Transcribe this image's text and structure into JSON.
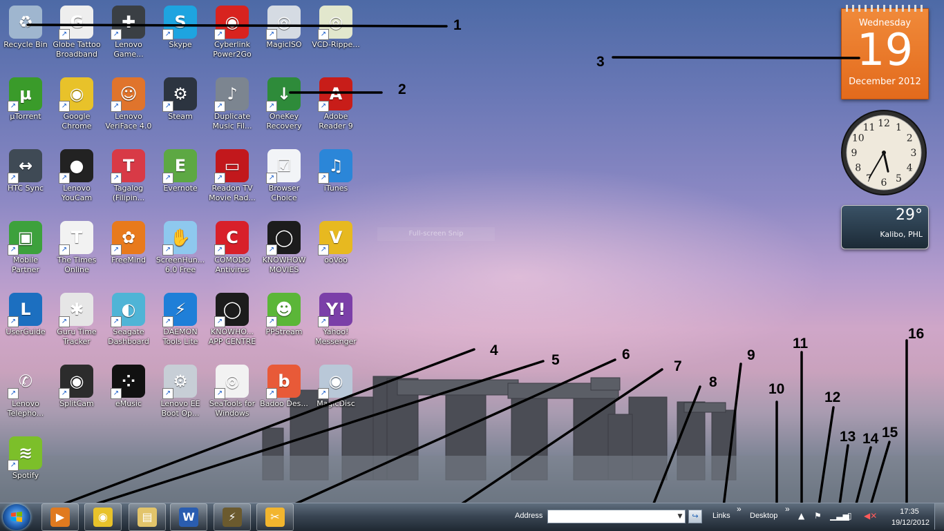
{
  "desktop": {
    "icons": [
      {
        "label": "Recycle Bin",
        "icon": "recycle-bin-icon",
        "color": "#9fb6cf",
        "glyph": "♻"
      },
      {
        "label": "Globe Tattoo Broadband",
        "icon": "globe-tattoo-icon",
        "color": "#eeeeee",
        "glyph": "G"
      },
      {
        "label": "Lenovo Game...",
        "icon": "gamepad-icon",
        "color": "#3a3f44",
        "glyph": "✚"
      },
      {
        "label": "Skype",
        "icon": "skype-icon",
        "color": "#1ea4e0",
        "glyph": "S"
      },
      {
        "label": "Cyberlink Power2Go",
        "icon": "cyberlink-icon",
        "color": "#d8231f",
        "glyph": "◉"
      },
      {
        "label": "MagicISO",
        "icon": "disc-icon",
        "color": "#d5dbe3",
        "glyph": "◎"
      },
      {
        "label": "VCD-Rippe...",
        "icon": "vcd-ripper-icon",
        "color": "#e2e7cd",
        "glyph": "◎"
      },
      {
        "label": "µTorrent",
        "icon": "utorrent-icon",
        "color": "#3a9b2a",
        "glyph": "µ"
      },
      {
        "label": "Google Chrome",
        "icon": "chrome-icon",
        "color": "#e8c22a",
        "glyph": "◉"
      },
      {
        "label": "Lenovo VeriFace 4.0",
        "icon": "veriface-icon",
        "color": "#e0742c",
        "glyph": "☺"
      },
      {
        "label": "Steam",
        "icon": "steam-icon",
        "color": "#2c3440",
        "glyph": "⚙"
      },
      {
        "label": "Duplicate Music Fil...",
        "icon": "speaker-icon",
        "color": "#7c8590",
        "glyph": "♪"
      },
      {
        "label": "OneKey Recovery",
        "icon": "onekey-recovery-icon",
        "color": "#2e8b3a",
        "glyph": "↓"
      },
      {
        "label": "Adobe Reader 9",
        "icon": "adobe-reader-icon",
        "color": "#c81d19",
        "glyph": "A"
      },
      {
        "label": "HTC Sync",
        "icon": "htc-sync-icon",
        "color": "#3f4a55",
        "glyph": "↔"
      },
      {
        "label": "Lenovo YouCam",
        "icon": "webcam-icon",
        "color": "#222222",
        "glyph": "●"
      },
      {
        "label": "Tagalog (Filipin...",
        "icon": "tagalog-icon",
        "color": "#d83a46",
        "glyph": "T"
      },
      {
        "label": "Evernote",
        "icon": "evernote-icon",
        "color": "#5da843",
        "glyph": "E"
      },
      {
        "label": "Readon TV Movie Rad...",
        "icon": "readon-tv-icon",
        "color": "#c2181c",
        "glyph": "▭"
      },
      {
        "label": "Browser Choice",
        "icon": "browser-choice-icon",
        "color": "#f2f4f7",
        "glyph": "☑"
      },
      {
        "label": "iTunes",
        "icon": "itunes-icon",
        "color": "#2b86d8",
        "glyph": "♫"
      },
      {
        "label": "Mobile Partner",
        "icon": "mobile-partner-icon",
        "color": "#3da13c",
        "glyph": "▣"
      },
      {
        "label": "The Times Online",
        "icon": "times-icon",
        "color": "#f2f2f2",
        "glyph": "T"
      },
      {
        "label": "FreeMind",
        "icon": "butterfly-icon",
        "color": "#e87a1c",
        "glyph": "✿"
      },
      {
        "label": "ScreenHun... 6.0 Free",
        "icon": "screenhunter-icon",
        "color": "#8ec8ee",
        "glyph": "✋"
      },
      {
        "label": "COMODO Antivirus",
        "icon": "comodo-icon",
        "color": "#d8202a",
        "glyph": "C"
      },
      {
        "label": "KNOWHOW MOVIES",
        "icon": "knowhow-movies-icon",
        "color": "#1c1c1c",
        "glyph": "◯"
      },
      {
        "label": "ooVoo",
        "icon": "oovoo-icon",
        "color": "#e7b920",
        "glyph": "V"
      },
      {
        "label": "UserGuide",
        "icon": "user-guide-icon",
        "color": "#1c6fc0",
        "glyph": "L"
      },
      {
        "label": "Guru Time Tracker",
        "icon": "guru-icon",
        "color": "#e6e6e6",
        "glyph": "✱"
      },
      {
        "label": "Seagate Dashboard",
        "icon": "seagate-icon",
        "color": "#4fb4d6",
        "glyph": "◐"
      },
      {
        "label": "DAEMON Tools Lite",
        "icon": "daemon-tools-icon",
        "color": "#1f7fd8",
        "glyph": "⚡"
      },
      {
        "label": "KNOWHO... APP CENTRE",
        "icon": "knowhow-app-icon",
        "color": "#1c1c1c",
        "glyph": "◯"
      },
      {
        "label": "PPStream",
        "icon": "ppstream-icon",
        "color": "#5bb638",
        "glyph": "☻"
      },
      {
        "label": "Yahoo! Messenger",
        "icon": "yahoo-messenger-icon",
        "color": "#7b3fa8",
        "glyph": "Y!"
      },
      {
        "label": "Lenovo Telepho...",
        "icon": "telephone-icon",
        "color": "transparent",
        "glyph": "✆"
      },
      {
        "label": "SplitCam",
        "icon": "splitcam-icon",
        "color": "#2c2c2c",
        "glyph": "◉"
      },
      {
        "label": "eMusic",
        "icon": "emusic-icon",
        "color": "#111111",
        "glyph": "⁘"
      },
      {
        "label": "Lenovo EE Boot Op...",
        "icon": "gear-icon",
        "color": "#c7ced6",
        "glyph": "⚙"
      },
      {
        "label": "SeaTools for Windows",
        "icon": "seatools-icon",
        "color": "#f2f2f2",
        "glyph": "◎"
      },
      {
        "label": "Badoo Des...",
        "icon": "badoo-icon",
        "color": "#e85a38",
        "glyph": "b"
      },
      {
        "label": "MagicDisc",
        "icon": "magicdisc-icon",
        "color": "#b9c8d8",
        "glyph": "◉"
      },
      {
        "label": "Spotify",
        "icon": "spotify-icon",
        "color": "#7cbf2a",
        "glyph": "≋"
      }
    ]
  },
  "gadgets": {
    "calendar": {
      "weekday": "Wednesday",
      "day": "19",
      "month_year": "December 2012"
    },
    "clock": {
      "hour": 5,
      "minute": 35,
      "numerals": [
        "12",
        "1",
        "2",
        "3",
        "4",
        "5",
        "6",
        "7",
        "8",
        "9",
        "10",
        "11"
      ]
    },
    "weather": {
      "temperature": "29°",
      "location": "Kalibo, PHL"
    }
  },
  "overlay": {
    "snip_label": "Full-screen Snip"
  },
  "annotations": [
    "1",
    "2",
    "3",
    "4",
    "5",
    "6",
    "7",
    "8",
    "9",
    "10",
    "11",
    "12",
    "13",
    "14",
    "15",
    "16"
  ],
  "taskbar": {
    "apps": [
      {
        "name": "media-player",
        "icon": "media-player-icon",
        "color": "#e07a1f",
        "glyph": "▶"
      },
      {
        "name": "chrome",
        "icon": "chrome-icon",
        "color": "#e8c22a",
        "glyph": "◉"
      },
      {
        "name": "explorer",
        "icon": "folder-icon",
        "color": "#e2c46a",
        "glyph": "▤"
      },
      {
        "name": "word",
        "icon": "word-icon",
        "color": "#2a5db0",
        "glyph": "W"
      },
      {
        "name": "winamp",
        "icon": "winamp-icon",
        "color": "#6b5a2e",
        "glyph": "⚡"
      },
      {
        "name": "snipping",
        "icon": "snipping-tool-icon",
        "color": "#f2b52e",
        "glyph": "✂"
      }
    ],
    "address_label": "Address",
    "address_value": "",
    "links_label": "Links",
    "desktop_label": "Desktop",
    "chevron": "»",
    "clock_time": "17:35",
    "clock_date": "19/12/2012",
    "tray_icons": [
      "show-hidden-icon",
      "flag-icon",
      "signal-icon",
      "battery-icon",
      "volume-muted-icon"
    ]
  }
}
